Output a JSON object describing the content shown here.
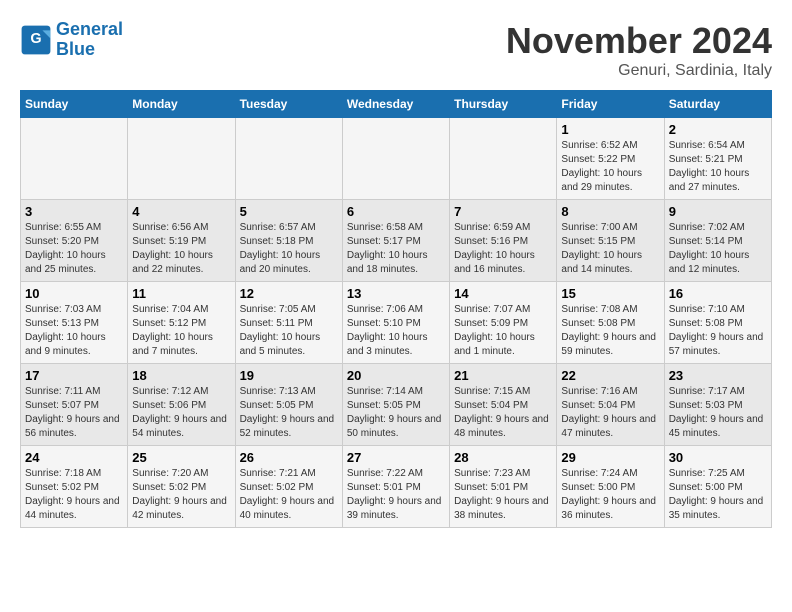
{
  "header": {
    "logo_line1": "General",
    "logo_line2": "Blue",
    "month_title": "November 2024",
    "subtitle": "Genuri, Sardinia, Italy"
  },
  "weekdays": [
    "Sunday",
    "Monday",
    "Tuesday",
    "Wednesday",
    "Thursday",
    "Friday",
    "Saturday"
  ],
  "weeks": [
    [
      {
        "day": "",
        "info": ""
      },
      {
        "day": "",
        "info": ""
      },
      {
        "day": "",
        "info": ""
      },
      {
        "day": "",
        "info": ""
      },
      {
        "day": "",
        "info": ""
      },
      {
        "day": "1",
        "info": "Sunrise: 6:52 AM\nSunset: 5:22 PM\nDaylight: 10 hours and 29 minutes."
      },
      {
        "day": "2",
        "info": "Sunrise: 6:54 AM\nSunset: 5:21 PM\nDaylight: 10 hours and 27 minutes."
      }
    ],
    [
      {
        "day": "3",
        "info": "Sunrise: 6:55 AM\nSunset: 5:20 PM\nDaylight: 10 hours and 25 minutes."
      },
      {
        "day": "4",
        "info": "Sunrise: 6:56 AM\nSunset: 5:19 PM\nDaylight: 10 hours and 22 minutes."
      },
      {
        "day": "5",
        "info": "Sunrise: 6:57 AM\nSunset: 5:18 PM\nDaylight: 10 hours and 20 minutes."
      },
      {
        "day": "6",
        "info": "Sunrise: 6:58 AM\nSunset: 5:17 PM\nDaylight: 10 hours and 18 minutes."
      },
      {
        "day": "7",
        "info": "Sunrise: 6:59 AM\nSunset: 5:16 PM\nDaylight: 10 hours and 16 minutes."
      },
      {
        "day": "8",
        "info": "Sunrise: 7:00 AM\nSunset: 5:15 PM\nDaylight: 10 hours and 14 minutes."
      },
      {
        "day": "9",
        "info": "Sunrise: 7:02 AM\nSunset: 5:14 PM\nDaylight: 10 hours and 12 minutes."
      }
    ],
    [
      {
        "day": "10",
        "info": "Sunrise: 7:03 AM\nSunset: 5:13 PM\nDaylight: 10 hours and 9 minutes."
      },
      {
        "day": "11",
        "info": "Sunrise: 7:04 AM\nSunset: 5:12 PM\nDaylight: 10 hours and 7 minutes."
      },
      {
        "day": "12",
        "info": "Sunrise: 7:05 AM\nSunset: 5:11 PM\nDaylight: 10 hours and 5 minutes."
      },
      {
        "day": "13",
        "info": "Sunrise: 7:06 AM\nSunset: 5:10 PM\nDaylight: 10 hours and 3 minutes."
      },
      {
        "day": "14",
        "info": "Sunrise: 7:07 AM\nSunset: 5:09 PM\nDaylight: 10 hours and 1 minute."
      },
      {
        "day": "15",
        "info": "Sunrise: 7:08 AM\nSunset: 5:08 PM\nDaylight: 9 hours and 59 minutes."
      },
      {
        "day": "16",
        "info": "Sunrise: 7:10 AM\nSunset: 5:08 PM\nDaylight: 9 hours and 57 minutes."
      }
    ],
    [
      {
        "day": "17",
        "info": "Sunrise: 7:11 AM\nSunset: 5:07 PM\nDaylight: 9 hours and 56 minutes."
      },
      {
        "day": "18",
        "info": "Sunrise: 7:12 AM\nSunset: 5:06 PM\nDaylight: 9 hours and 54 minutes."
      },
      {
        "day": "19",
        "info": "Sunrise: 7:13 AM\nSunset: 5:05 PM\nDaylight: 9 hours and 52 minutes."
      },
      {
        "day": "20",
        "info": "Sunrise: 7:14 AM\nSunset: 5:05 PM\nDaylight: 9 hours and 50 minutes."
      },
      {
        "day": "21",
        "info": "Sunrise: 7:15 AM\nSunset: 5:04 PM\nDaylight: 9 hours and 48 minutes."
      },
      {
        "day": "22",
        "info": "Sunrise: 7:16 AM\nSunset: 5:04 PM\nDaylight: 9 hours and 47 minutes."
      },
      {
        "day": "23",
        "info": "Sunrise: 7:17 AM\nSunset: 5:03 PM\nDaylight: 9 hours and 45 minutes."
      }
    ],
    [
      {
        "day": "24",
        "info": "Sunrise: 7:18 AM\nSunset: 5:02 PM\nDaylight: 9 hours and 44 minutes."
      },
      {
        "day": "25",
        "info": "Sunrise: 7:20 AM\nSunset: 5:02 PM\nDaylight: 9 hours and 42 minutes."
      },
      {
        "day": "26",
        "info": "Sunrise: 7:21 AM\nSunset: 5:02 PM\nDaylight: 9 hours and 40 minutes."
      },
      {
        "day": "27",
        "info": "Sunrise: 7:22 AM\nSunset: 5:01 PM\nDaylight: 9 hours and 39 minutes."
      },
      {
        "day": "28",
        "info": "Sunrise: 7:23 AM\nSunset: 5:01 PM\nDaylight: 9 hours and 38 minutes."
      },
      {
        "day": "29",
        "info": "Sunrise: 7:24 AM\nSunset: 5:00 PM\nDaylight: 9 hours and 36 minutes."
      },
      {
        "day": "30",
        "info": "Sunrise: 7:25 AM\nSunset: 5:00 PM\nDaylight: 9 hours and 35 minutes."
      }
    ]
  ]
}
